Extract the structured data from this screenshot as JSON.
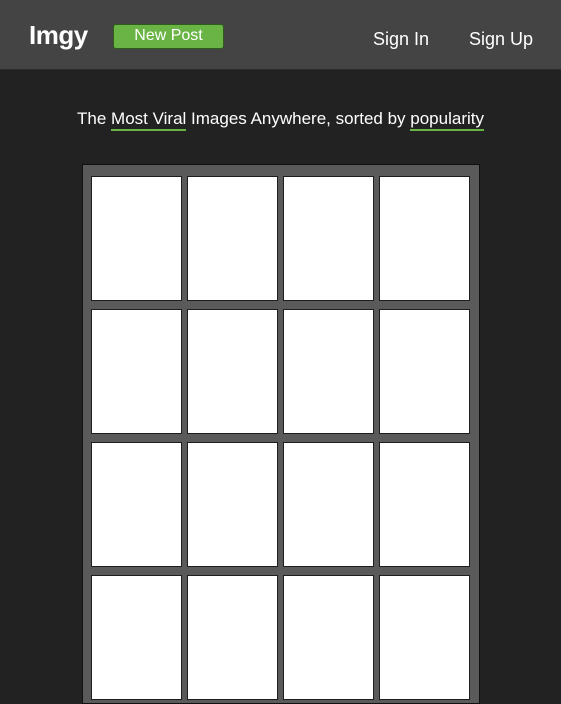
{
  "header": {
    "logo": "Imgy",
    "new_post_label": "New Post",
    "sign_in_label": "Sign In",
    "sign_up_label": "Sign Up"
  },
  "tagline": {
    "prefix": "The ",
    "link1": "Most Viral",
    "middle": " Images Anywhere, sorted by ",
    "link2": "popularity"
  },
  "colors": {
    "accent": "#6ab446",
    "header_bg": "#444444",
    "page_bg": "#222222",
    "grid_bg": "#5a5a5a"
  },
  "gallery": {
    "columns": 4,
    "visible_rows": 4
  }
}
